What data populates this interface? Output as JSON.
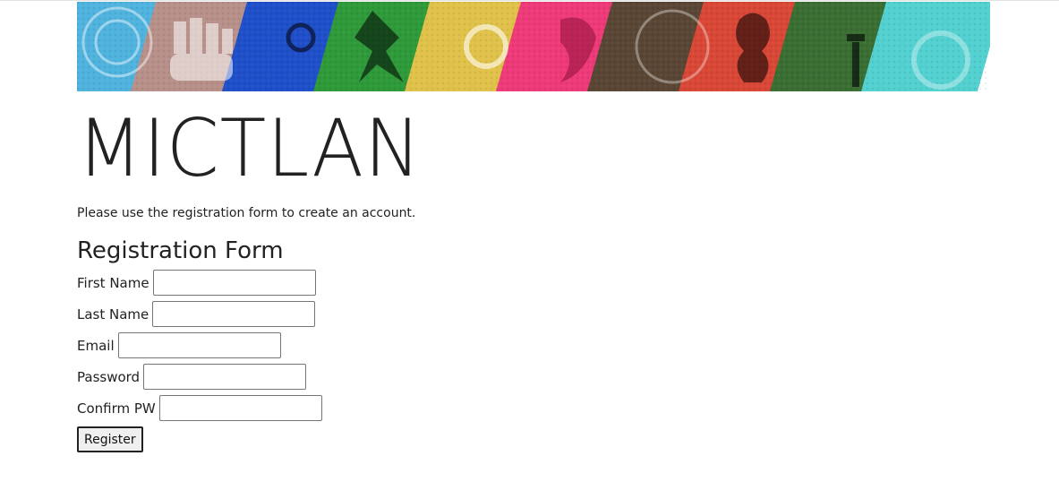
{
  "site": {
    "title": "MICTLAN",
    "intro": "Please use the registration form to create an account."
  },
  "banner": {
    "tile_colors": [
      "#4fb3de",
      "#b8908a",
      "#1f4fc9",
      "#2f9a3a",
      "#e0c24a",
      "#ef3a7a",
      "#5a4634",
      "#d94836",
      "#3a6e33",
      "#53d0d0"
    ]
  },
  "form": {
    "heading": "Registration Form",
    "fields": [
      {
        "label": "First Name",
        "value": "",
        "type": "text"
      },
      {
        "label": "Last Name",
        "value": "",
        "type": "text"
      },
      {
        "label": "Email",
        "value": "",
        "type": "email"
      },
      {
        "label": "Password",
        "value": "",
        "type": "password"
      },
      {
        "label": "Confirm PW",
        "value": "",
        "type": "password"
      }
    ],
    "submit_label": "Register"
  }
}
